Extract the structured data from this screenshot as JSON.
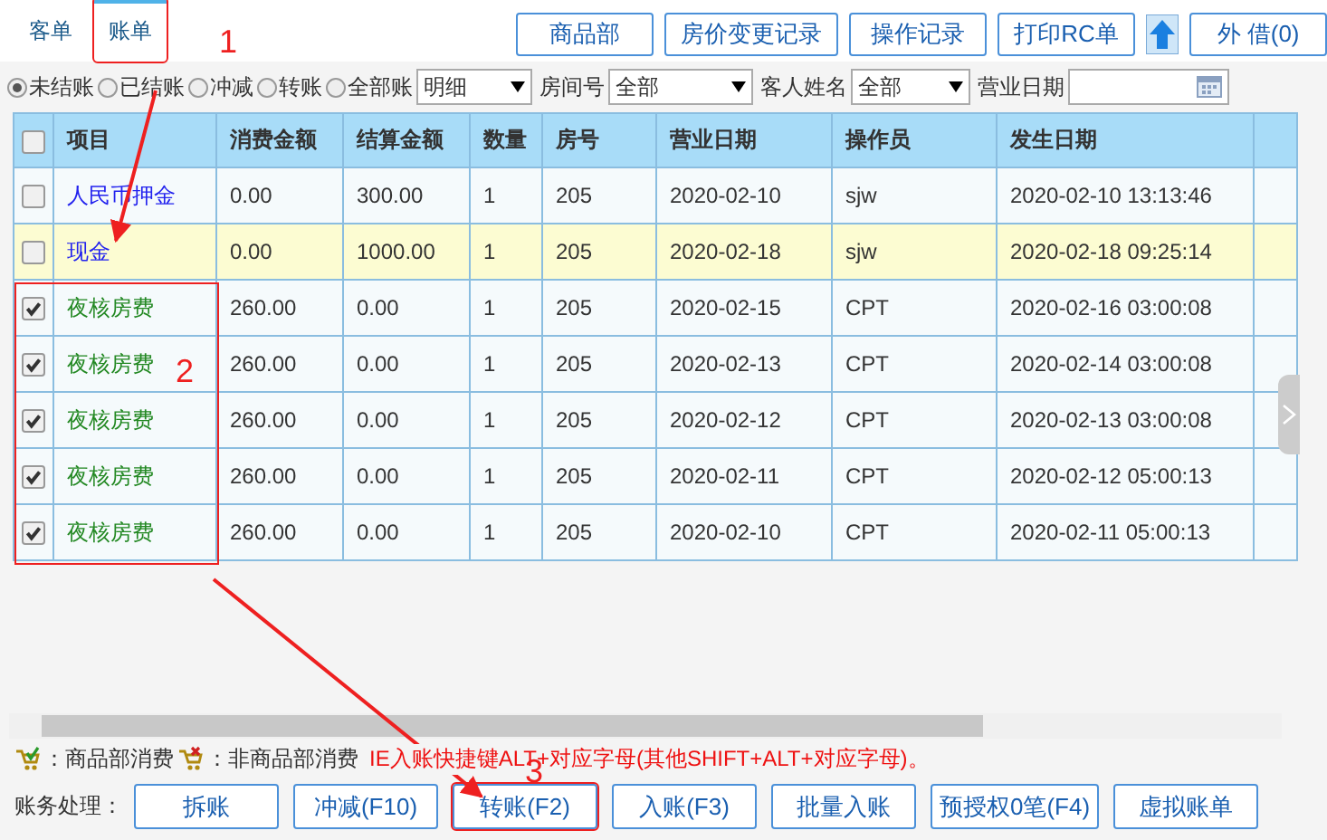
{
  "tabs": [
    {
      "label": "客单",
      "selected": false,
      "annotated": false
    },
    {
      "label": "账单",
      "selected": true,
      "annotated": true
    }
  ],
  "top_buttons": [
    {
      "label": "商品部",
      "kind": "text"
    },
    {
      "label": "房价变更记录",
      "kind": "text"
    },
    {
      "label": "操作记录",
      "kind": "text"
    },
    {
      "label": "打印RC单",
      "kind": "text"
    },
    {
      "kind": "up"
    },
    {
      "label": "外 借(0)",
      "kind": "text"
    }
  ],
  "filters": {
    "radios": [
      {
        "label": "未结账",
        "selected": true
      },
      {
        "label": "已结账",
        "selected": false
      },
      {
        "label": "冲减",
        "selected": false
      },
      {
        "label": "转账",
        "selected": false
      },
      {
        "label": "全部账",
        "selected": false
      }
    ],
    "selects": [
      {
        "value": "明细"
      },
      {
        "label": "房间号",
        "value": "全部"
      },
      {
        "label": "客人姓名",
        "value": "全部"
      }
    ],
    "date_label": "营业日期"
  },
  "table": {
    "header_checked": false,
    "columns": [
      "项目",
      "消费金额",
      "结算金额",
      "数量",
      "房号",
      "营业日期",
      "操作员",
      "发生日期"
    ],
    "rows": [
      {
        "checked": false,
        "highlighted": false,
        "color": "#2222ee",
        "cells": [
          "人民币押金",
          "0.00",
          "300.00",
          "1",
          "205",
          "2020-02-10",
          "sjw",
          "2020-02-10 13:13:46"
        ]
      },
      {
        "checked": false,
        "highlighted": true,
        "color": "#2222ee",
        "cells": [
          "现金",
          "0.00",
          "1000.00",
          "1",
          "205",
          "2020-02-18",
          "sjw",
          "2020-02-18 09:25:14"
        ]
      },
      {
        "checked": true,
        "highlighted": false,
        "color": "#228822",
        "cells": [
          "夜核房费",
          "260.00",
          "0.00",
          "1",
          "205",
          "2020-02-15",
          "CPT",
          "2020-02-16 03:00:08"
        ]
      },
      {
        "checked": true,
        "highlighted": false,
        "color": "#228822",
        "cells": [
          "夜核房费",
          "260.00",
          "0.00",
          "1",
          "205",
          "2020-02-13",
          "CPT",
          "2020-02-14 03:00:08"
        ]
      },
      {
        "checked": true,
        "highlighted": false,
        "color": "#228822",
        "cells": [
          "夜核房费",
          "260.00",
          "0.00",
          "1",
          "205",
          "2020-02-12",
          "CPT",
          "2020-02-13 03:00:08"
        ]
      },
      {
        "checked": true,
        "highlighted": false,
        "color": "#228822",
        "cells": [
          "夜核房费",
          "260.00",
          "0.00",
          "1",
          "205",
          "2020-02-11",
          "CPT",
          "2020-02-12 05:00:13"
        ]
      },
      {
        "checked": true,
        "highlighted": false,
        "color": "#228822",
        "cells": [
          "夜核房费",
          "260.00",
          "0.00",
          "1",
          "205",
          "2020-02-10",
          "CPT",
          "2020-02-11 05:00:13"
        ]
      }
    ]
  },
  "legend": {
    "goods": "：商品部消费",
    "non_goods": "：非商品部消费",
    "hint": "IE入账快捷键ALT+对应字母(其他SHIFT+ALT+对应字母)。"
  },
  "actions": {
    "label": "账务处理：",
    "buttons": [
      {
        "label": "拆账",
        "annotated": false
      },
      {
        "label": "冲减(F10)",
        "annotated": false
      },
      {
        "label": "转账(F2)",
        "annotated": true
      },
      {
        "label": "入账(F3)",
        "annotated": false
      },
      {
        "label": "批量入账",
        "annotated": false
      },
      {
        "label": "预授权0笔(F4)",
        "annotated": false
      },
      {
        "label": "虚拟账单",
        "annotated": false
      }
    ]
  },
  "annotations": [
    {
      "label": "1"
    },
    {
      "label": "2"
    },
    {
      "label": "3"
    }
  ]
}
